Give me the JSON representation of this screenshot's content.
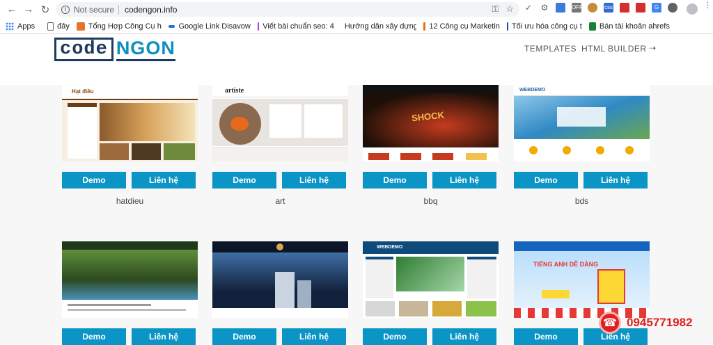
{
  "browser": {
    "security_label": "Not secure",
    "url": "codengon.info",
    "bookmarks": [
      {
        "label": "Apps",
        "color": "#4285f4"
      },
      {
        "label": "đây",
        "color": "#5f6368"
      },
      {
        "label": "Tổng Hợp Công Cụ h",
        "color": "#e3742c"
      },
      {
        "label": "Google Link Disavow",
        "color": "#1a73e8"
      },
      {
        "label": "Viết bài chuẩn seo: 4",
        "color": "#a142f4"
      },
      {
        "label": "Hướng dẫn xây dựng",
        "color": "#f29900"
      },
      {
        "label": "12 Công cụ Marketin",
        "color": "#e8710a"
      },
      {
        "label": "Tối ưu hóa công cụ t",
        "color": "#174ea6"
      },
      {
        "label": "Bán tài khoản ahrefs",
        "color": "#188038"
      }
    ]
  },
  "site": {
    "logo_code": "code",
    "logo_ngon": "NGON",
    "nav": [
      {
        "label": "TEMPLATES"
      },
      {
        "label": "HTML BUILDER"
      }
    ]
  },
  "templates": [
    {
      "name": "hatdieu",
      "demo": "Demo",
      "contact": "Liên hệ",
      "colors": [
        "#6b3d12",
        "#f6efe2",
        "#c98b3a"
      ],
      "headline": "Hạt điều"
    },
    {
      "name": "art",
      "demo": "Demo",
      "contact": "Liên hệ",
      "colors": [
        "#e8e4df",
        "#8a6a4e",
        "#1b1b1b"
      ],
      "headline": "artiste"
    },
    {
      "name": "bbq",
      "demo": "Demo",
      "contact": "Liên hệ",
      "colors": [
        "#1b0f08",
        "#c63b1f",
        "#f2c14e"
      ],
      "headline": "SHOCK"
    },
    {
      "name": "bds",
      "demo": "Demo",
      "contact": "Liên hệ",
      "colors": [
        "#1f66a8",
        "#8ec7e8",
        "#ffffff"
      ],
      "headline": "WEBDEMO"
    },
    {
      "name": "",
      "demo": "Demo",
      "contact": "Liên hệ",
      "colors": [
        "#2d4a1f",
        "#5f8f3a",
        "#e9efe3"
      ],
      "headline": ""
    },
    {
      "name": "",
      "demo": "Demo",
      "contact": "Liên hệ",
      "colors": [
        "#12213b",
        "#3f6fa5",
        "#d9a84e"
      ],
      "headline": ""
    },
    {
      "name": "",
      "demo": "Demo",
      "contact": "Liên hệ",
      "colors": [
        "#0e4a7a",
        "#ffffff",
        "#2e7d32"
      ],
      "headline": "WEBDEMO"
    },
    {
      "name": "",
      "demo": "Demo",
      "contact": "Liên hệ",
      "colors": [
        "#1565c0",
        "#e53935",
        "#fdd835"
      ],
      "headline": "TIẾNG ANH DỄ DÀNG"
    }
  ],
  "hotline": "0945771982"
}
